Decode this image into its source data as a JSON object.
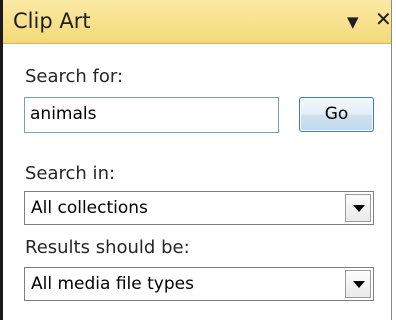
{
  "pane": {
    "title": "Clip Art",
    "dropdown_icon": "▼",
    "close_icon": "✕"
  },
  "search": {
    "label": "Search for:",
    "value": "animals",
    "go_label": "Go"
  },
  "search_in": {
    "label": "Search in:",
    "selected": "All collections"
  },
  "results": {
    "label": "Results should be:",
    "selected": "All media file types"
  }
}
